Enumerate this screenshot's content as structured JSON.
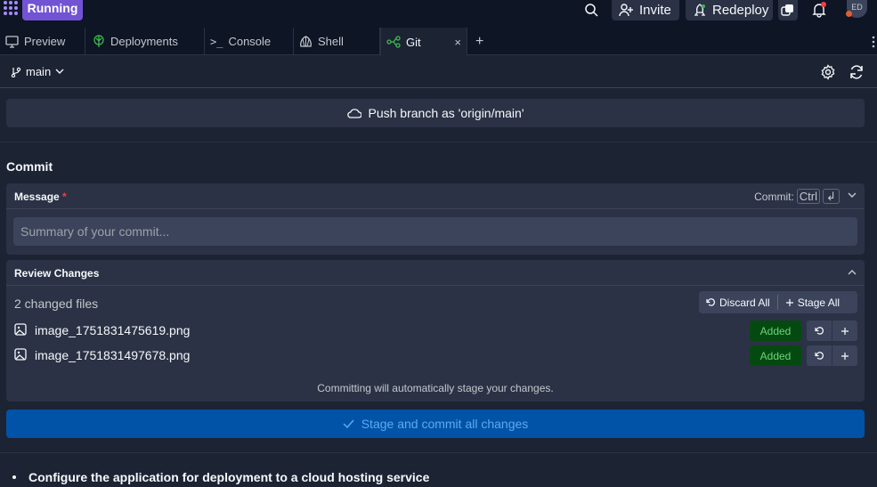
{
  "topbar": {
    "run_label": "Running",
    "invite_label": "Invite",
    "redeploy_label": "Redeploy",
    "avatar_initials": "ED",
    "icons": [
      "logo-icon",
      "search-icon",
      "add-user-icon",
      "redeploy-icon",
      "copy-icon",
      "bell-icon"
    ]
  },
  "tabs": [
    {
      "label": "Preview",
      "icon": "monitor-icon",
      "active": false
    },
    {
      "label": "Deployments",
      "icon": "deployments-icon",
      "active": false
    },
    {
      "label": "Console",
      "icon": "console-icon",
      "active": false
    },
    {
      "label": "Shell",
      "icon": "shell-icon",
      "active": false
    },
    {
      "label": "Git",
      "icon": "git-icon",
      "active": true
    }
  ],
  "tab_close": "×",
  "tab_add": "+",
  "git": {
    "branch": "main",
    "push_label": "Push branch as 'origin/main'",
    "commit_heading": "Commit",
    "message": {
      "label": "Message",
      "required_mark": "*",
      "commit_hint": "Commit:",
      "kbd_ctrl": "Ctrl",
      "kbd_enter": "↲",
      "placeholder": "Summary of your commit...",
      "value": ""
    },
    "review": {
      "title": "Review Changes",
      "count_label": "2 changed files",
      "discard_all": "Discard All",
      "stage_all": "Stage All",
      "files": [
        {
          "name": "image_1751831475619.png",
          "status": "Added"
        },
        {
          "name": "image_1751831497678.png",
          "status": "Added"
        }
      ],
      "note": "Committing will automatically stage your changes."
    },
    "stage_commit_label": "Stage and commit all changes"
  },
  "agent": {
    "bullet_text": "Configure the application for deployment to a cloud hosting service"
  },
  "colors": {
    "background": "#1c2333",
    "topbar": "#0e1525",
    "panel": "#2b3245",
    "accent_purple": "#7153d3",
    "primary_blue": "#0053a6",
    "added_green": "#6bd47c"
  }
}
